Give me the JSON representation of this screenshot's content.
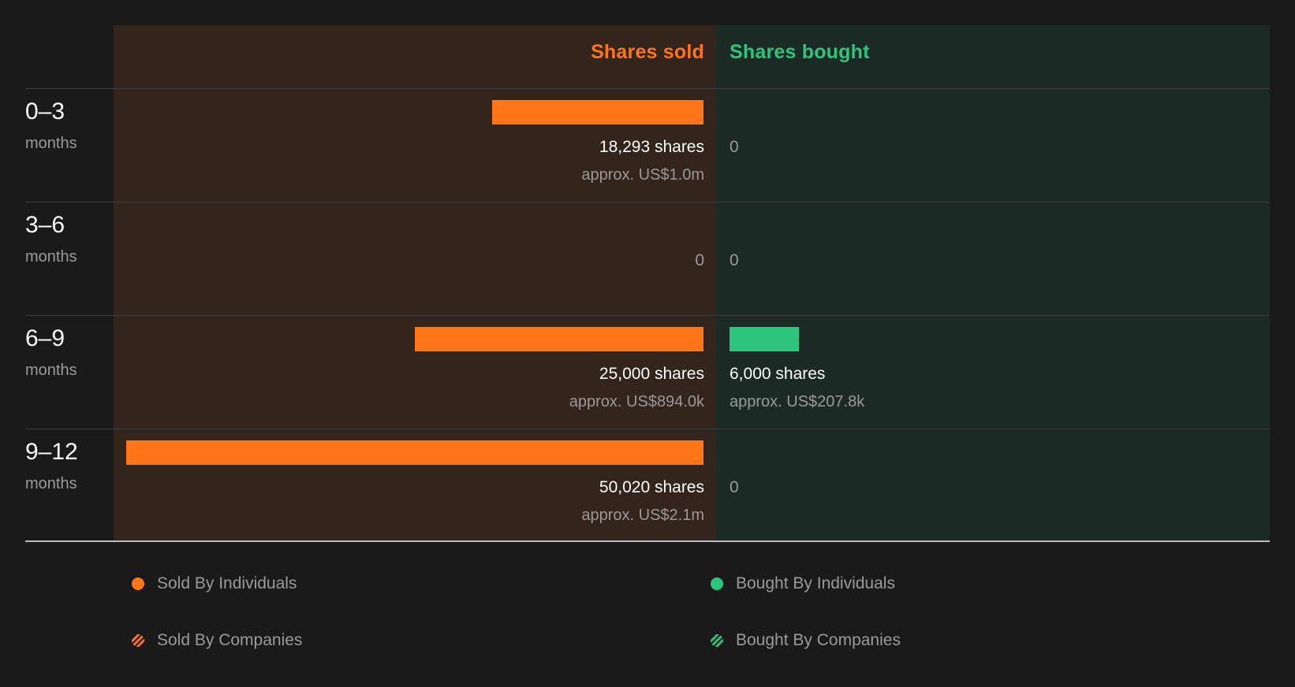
{
  "colors": {
    "sold": "#ff7518",
    "bought": "#2dc57d",
    "sold_panel": "#33241c",
    "bought_panel": "#1c2a25"
  },
  "headers": {
    "sold": "Shares sold",
    "bought": "Shares bought"
  },
  "chart_data": {
    "type": "bar",
    "orientation": "horizontal-diverging",
    "categories": [
      "0–3",
      "3–6",
      "6–9",
      "9–12"
    ],
    "category_unit": "months",
    "series": [
      {
        "name": "Shares sold",
        "values": [
          18293,
          0,
          25000,
          50020
        ],
        "labels": [
          "18,293 shares",
          "0",
          "25,000 shares",
          "50,020 shares"
        ],
        "value_labels": [
          "approx. US$1.0m",
          "",
          "approx. US$894.0k",
          "approx. US$2.1m"
        ]
      },
      {
        "name": "Shares bought",
        "values": [
          0,
          0,
          6000,
          0
        ],
        "labels": [
          "0",
          "0",
          "6,000 shares",
          "0"
        ],
        "value_labels": [
          "",
          "",
          "approx. US$207.8k",
          ""
        ]
      }
    ],
    "xlim": [
      0,
      50020
    ],
    "grid": false,
    "legend_position": "bottom",
    "legend": [
      {
        "label": "Sold By Individuals",
        "color": "#ff7518",
        "style": "solid"
      },
      {
        "label": "Bought By Individuals",
        "color": "#2dc57d",
        "style": "solid"
      },
      {
        "label": "Sold By Companies",
        "color": "#ff7518",
        "style": "striped"
      },
      {
        "label": "Bought By Companies",
        "color": "#2dc57d",
        "style": "striped"
      }
    ]
  }
}
